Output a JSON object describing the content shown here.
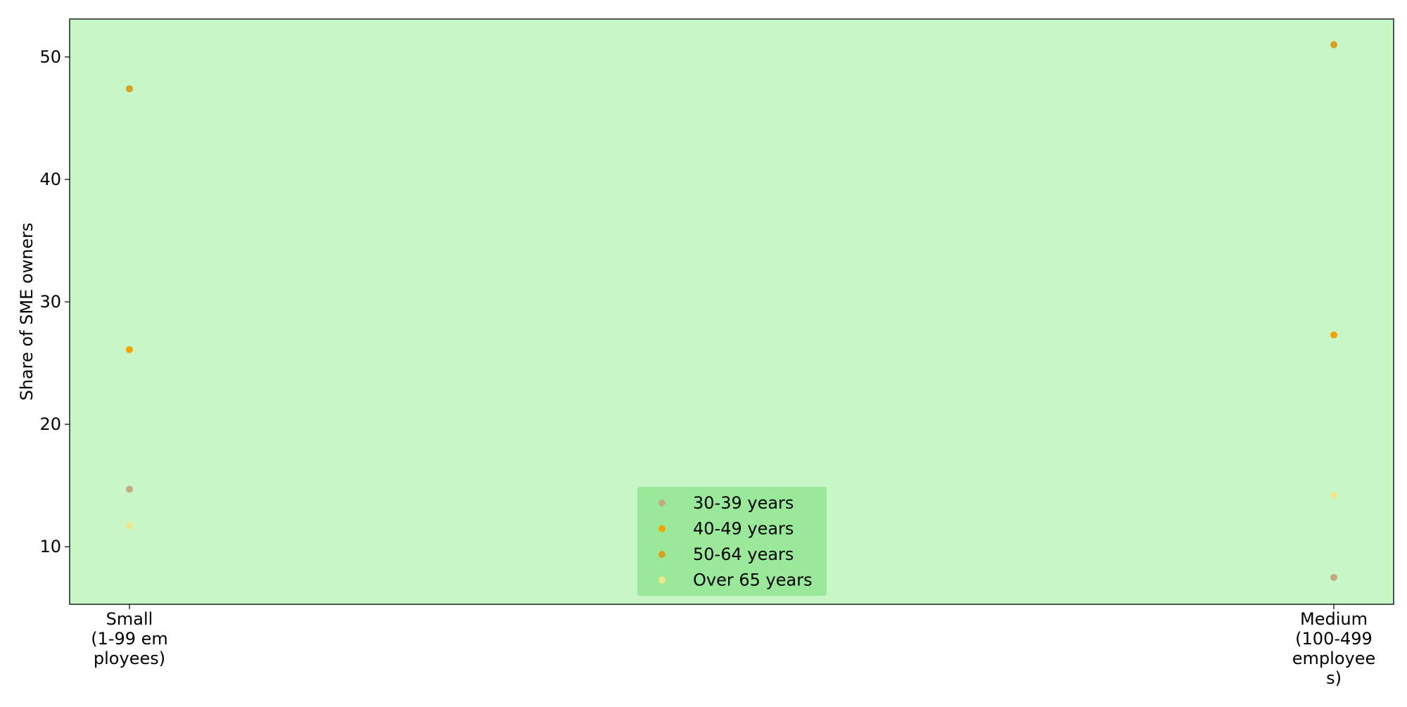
{
  "chart_data": {
    "type": "scatter",
    "title": "",
    "xlabel": "",
    "ylabel": "Share of SME owners",
    "categories": [
      [
        "Small",
        "(1-99 em",
        "ployees)"
      ],
      [
        "Medium",
        "(100-499",
        "employee",
        "s)"
      ]
    ],
    "ylim": [
      5.3,
      53.1
    ],
    "yticks": [
      10,
      20,
      30,
      40,
      50
    ],
    "grid": false,
    "legend_position": "lower center",
    "series": [
      {
        "name": "30-39 years",
        "color": "#c8aa80",
        "values": [
          14.7,
          7.5
        ]
      },
      {
        "name": "40-49 years",
        "color": "#f5a300",
        "values": [
          26.1,
          27.3
        ]
      },
      {
        "name": "50-64 years",
        "color": "#d7a020",
        "values": [
          47.4,
          51.0
        ]
      },
      {
        "name": "Over 65 years",
        "color": "#f0e68c",
        "values": [
          11.7,
          14.2
        ]
      }
    ],
    "colors": {
      "plot_background": "#c7f7c7",
      "legend_background": "#9ae99a"
    }
  }
}
